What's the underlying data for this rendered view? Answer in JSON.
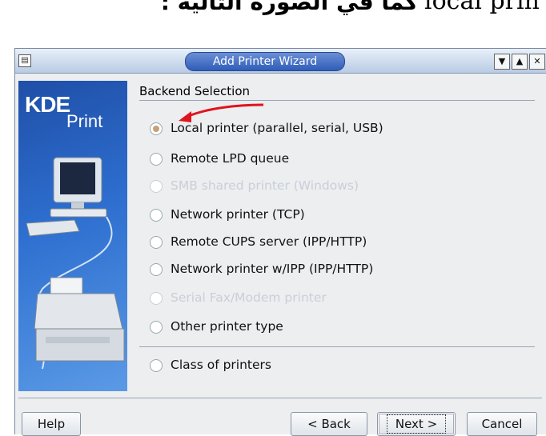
{
  "caption": {
    "latin": "local prin",
    "arabic": "كما في الصورة التالية :"
  },
  "window": {
    "title": "Add Printer Wizard",
    "menu_icon": "window-menu-icon",
    "controls": [
      "shade-icon",
      "maximize-icon",
      "close-icon"
    ]
  },
  "sidebar": {
    "logo_kde": "KDE",
    "logo_print": "Print"
  },
  "section": {
    "title": "Backend Selection"
  },
  "options": [
    {
      "label": "Local printer (parallel, serial, USB)",
      "checked": true,
      "enabled": true
    },
    {
      "label": "Remote LPD queue",
      "checked": false,
      "enabled": true
    },
    {
      "label": "SMB shared printer (Windows)",
      "checked": false,
      "enabled": false
    },
    {
      "label": "Network printer (TCP)",
      "checked": false,
      "enabled": true
    },
    {
      "label": "Remote CUPS server (IPP/HTTP)",
      "checked": false,
      "enabled": true
    },
    {
      "label": "Network printer w/IPP (IPP/HTTP)",
      "checked": false,
      "enabled": true
    },
    {
      "label": "Serial Fax/Modem printer",
      "checked": false,
      "enabled": false
    },
    {
      "label": "Other printer type",
      "checked": false,
      "enabled": true
    },
    {
      "label": "Class of printers",
      "checked": false,
      "enabled": true
    }
  ],
  "buttons": {
    "help": "Help",
    "back": "< Back",
    "next": "Next >",
    "cancel": "Cancel"
  },
  "colors": {
    "annotation_arrow": "#e0141e",
    "title_pill": "#2f5db8",
    "sidebar": "#2e6fd0"
  }
}
